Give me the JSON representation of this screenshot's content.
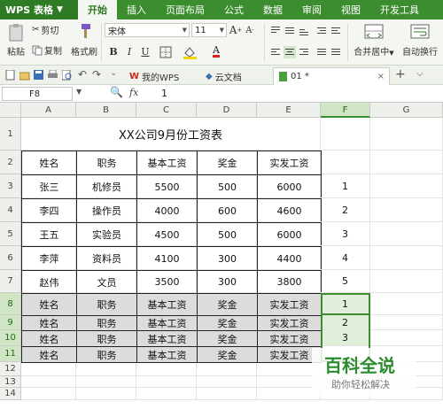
{
  "app": {
    "name": "WPS 表格"
  },
  "menu": [
    "开始",
    "插入",
    "页面布局",
    "公式",
    "数据",
    "审阅",
    "视图",
    "开发工具"
  ],
  "ribbon": {
    "paste": "粘贴",
    "cut": "剪切",
    "copy": "复制",
    "format_painter": "格式刷",
    "font_name": "宋体",
    "font_size": "11",
    "merge_center": "合并居中",
    "wrap_text": "自动换行",
    "font_buttons": [
      "B",
      "I",
      "U"
    ]
  },
  "doc_tabs": [
    {
      "label": "我的WPS"
    },
    {
      "label": "云文档"
    },
    {
      "label": "01 *"
    }
  ],
  "formula_bar": {
    "cell_ref": "F8",
    "fx": "fx",
    "value": "1"
  },
  "columns": [
    "A",
    "B",
    "C",
    "D",
    "E",
    "F",
    "G"
  ],
  "rows": [
    "1",
    "2",
    "3",
    "4",
    "5",
    "6",
    "7",
    "8",
    "9",
    "10",
    "11",
    "12",
    "13",
    "14"
  ],
  "sheet": {
    "title": "XX公司9月份工资表",
    "headers": [
      "姓名",
      "职务",
      "基本工资",
      "奖金",
      "实发工资"
    ],
    "records": [
      [
        "张三",
        "机修员",
        "5500",
        "500",
        "6000"
      ],
      [
        "李四",
        "操作员",
        "4000",
        "600",
        "4600"
      ],
      [
        "王五",
        "实验员",
        "4500",
        "500",
        "6000"
      ],
      [
        "李萍",
        "资料员",
        "4100",
        "300",
        "4400"
      ],
      [
        "赵伟",
        "文员",
        "3500",
        "300",
        "3800"
      ]
    ],
    "f_values": [
      "1",
      "2",
      "3",
      "4",
      "5",
      "1",
      "2",
      "3"
    ]
  },
  "watermark": {
    "title": "百科全说",
    "subtitle": "助你轻松解决"
  },
  "colors": {
    "accent": "#3c8d2f",
    "selection": "#e1efda",
    "shade": "#dcdcdc"
  }
}
